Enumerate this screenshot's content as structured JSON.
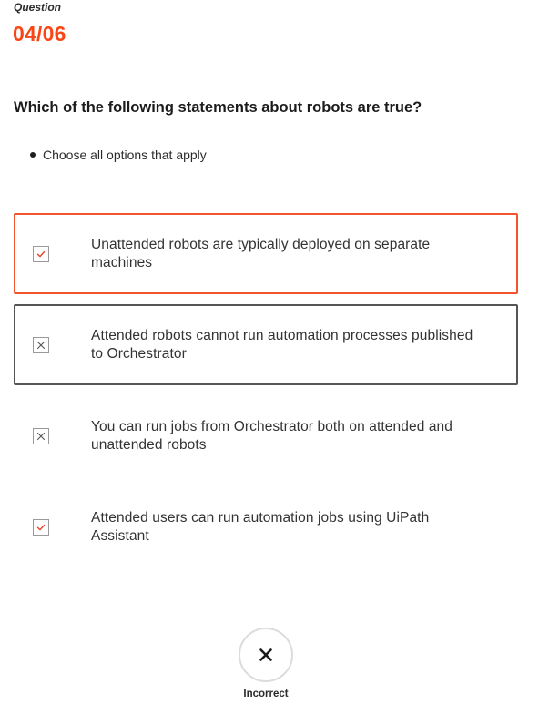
{
  "question": {
    "label": "Question",
    "number": "04/06",
    "text": "Which of the following statements about robots are true?",
    "instruction": "Choose all options that apply"
  },
  "options": [
    {
      "text": "Unattended robots are typically deployed on separate machines",
      "mark": "check",
      "state": "selected-correct"
    },
    {
      "text": "Attended robots cannot run automation processes published to Orchestrator",
      "mark": "cross",
      "state": "selected-wrong"
    },
    {
      "text": "You can run jobs from Orchestrator both on attended and unattended robots",
      "mark": "cross",
      "state": "unselected"
    },
    {
      "text": "Attended users can run automation jobs using UiPath Assistant",
      "mark": "check",
      "state": "unselected"
    }
  ],
  "result": {
    "icon": "close-icon",
    "label": "Incorrect"
  },
  "colors": {
    "accent": "#fa4616",
    "correct_border": "#f2542d",
    "wrong_border": "#555555",
    "check": "#e8452c",
    "cross": "#555555"
  }
}
